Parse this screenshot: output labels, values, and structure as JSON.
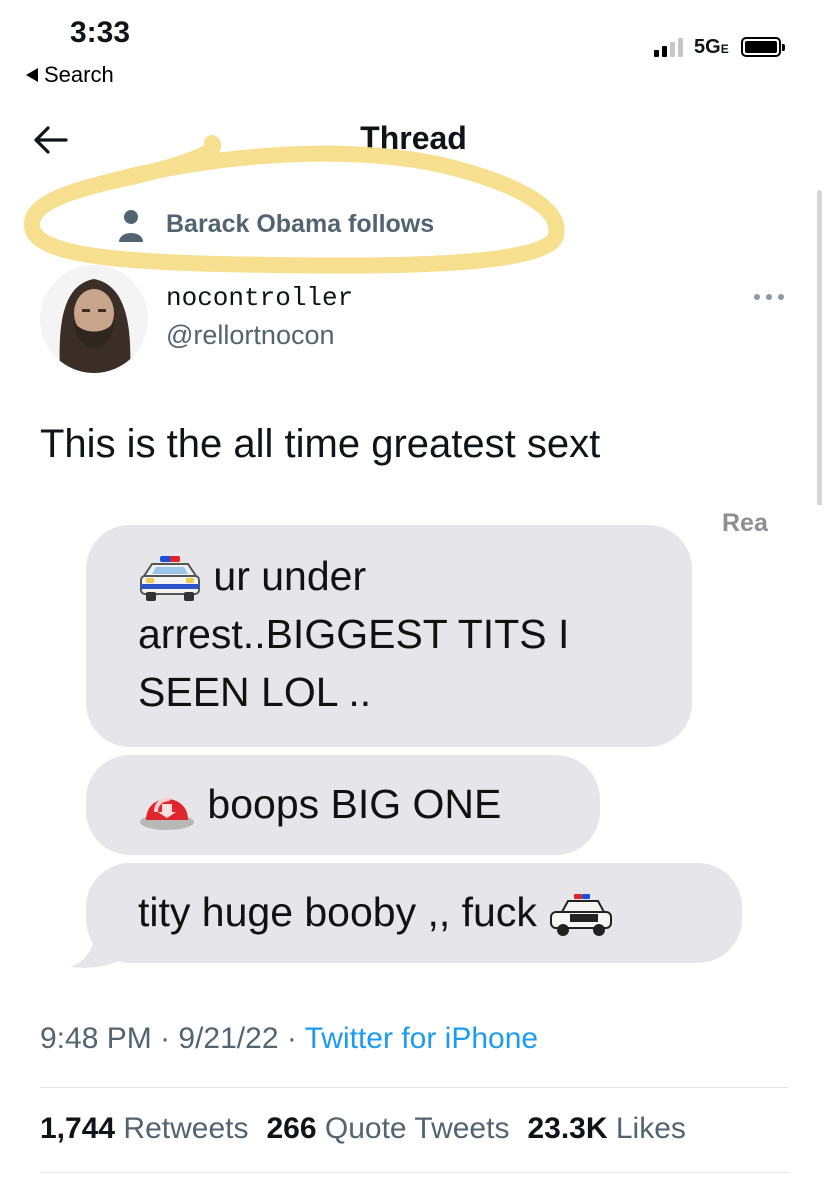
{
  "status_bar": {
    "time": "3:33",
    "back_label": "Search",
    "network": "5G",
    "network_suffix": "E"
  },
  "header": {
    "title": "Thread",
    "back_icon": "arrow-left-icon"
  },
  "social_context": {
    "icon": "person-icon",
    "text": "Barack Obama follows",
    "highlight_color": "#f5dc82"
  },
  "author": {
    "display_name": "nocontroller",
    "handle": "@rellortnocon"
  },
  "tweet": {
    "text": "This is the all time greatest sext",
    "media": {
      "corner_text": "Rea",
      "messages": [
        {
          "emoji": "police-car-icon",
          "text": "ur under arrest..BIGGEST TITS I SEEN LOL .."
        },
        {
          "emoji": "police-light-icon",
          "text": "boops BIG ONE"
        },
        {
          "text": "tity huge booby ,, fuck",
          "trailing_emoji": "police-car-icon"
        }
      ]
    },
    "time": "9:48 PM",
    "date": "9/21/22",
    "source": "Twitter for iPhone"
  },
  "stats": {
    "retweets_count": "1,744",
    "retweets_label": "Retweets",
    "quotes_count": "266",
    "quotes_label": "Quote Tweets",
    "likes_count": "23.3K",
    "likes_label": "Likes"
  },
  "colors": {
    "link": "#1d9bf0",
    "secondary_text": "#536471",
    "bubble": "#e5e5ea"
  }
}
